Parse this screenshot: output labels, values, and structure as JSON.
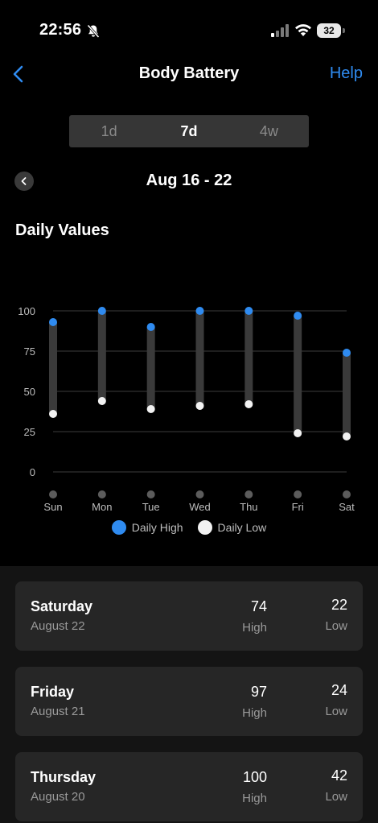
{
  "status": {
    "time": "22:56",
    "battery": "32"
  },
  "nav": {
    "title": "Body Battery",
    "help": "Help"
  },
  "tabs": [
    {
      "label": "1d",
      "active": false
    },
    {
      "label": "7d",
      "active": true
    },
    {
      "label": "4w",
      "active": false
    }
  ],
  "date_range": "Aug 16 - 22",
  "section_title": "Daily Values",
  "chart_data": {
    "type": "range-bar",
    "categories": [
      "Sun",
      "Mon",
      "Tue",
      "Wed",
      "Thu",
      "Fri",
      "Sat"
    ],
    "series": [
      {
        "name": "Daily High",
        "values": [
          93,
          100,
          90,
          100,
          100,
          97,
          74
        ]
      },
      {
        "name": "Daily Low",
        "values": [
          36,
          44,
          39,
          41,
          42,
          24,
          22
        ]
      }
    ],
    "yticks": [
      "100",
      "75",
      "50",
      "25",
      "0"
    ],
    "ylim": [
      0,
      100
    ],
    "grid": true,
    "legend_position": "bottom",
    "colors": {
      "high": "#2f8bf0",
      "low": "#f2f2f2",
      "bar": "#3a3a3a",
      "grid": "#3c3c3c"
    }
  },
  "legend": {
    "high": "Daily High",
    "low": "Daily Low"
  },
  "cards": [
    {
      "day": "Saturday",
      "date": "August 22",
      "high": "74",
      "high_label": "High",
      "low": "22",
      "low_label": "Low"
    },
    {
      "day": "Friday",
      "date": "August 21",
      "high": "97",
      "high_label": "High",
      "low": "24",
      "low_label": "Low"
    },
    {
      "day": "Thursday",
      "date": "August 20",
      "high": "100",
      "high_label": "High",
      "low": "42",
      "low_label": "Low"
    }
  ]
}
